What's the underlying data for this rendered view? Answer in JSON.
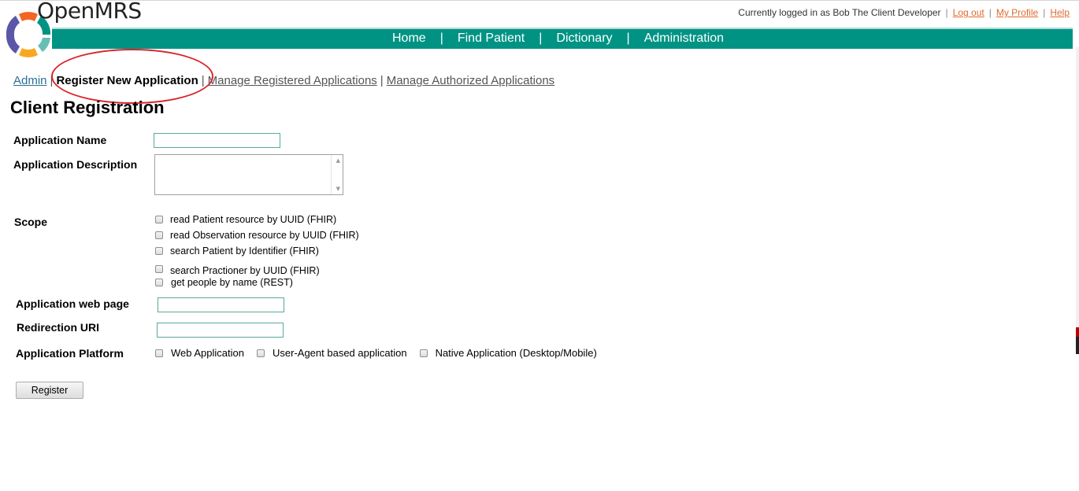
{
  "app": {
    "logo_text": "OpenMRS"
  },
  "userbar": {
    "logged_in_text": "Currently logged in as Bob The Client Developer",
    "logout": "Log out",
    "my_profile": "My Profile",
    "help": "Help"
  },
  "nav": [
    "Home",
    "Find Patient",
    "Dictionary",
    "Administration"
  ],
  "breadcrumbs": {
    "admin": "Admin",
    "register": "Register New Application",
    "manage_registered": "Manage Registered Applications",
    "manage_authorized": "Manage Authorized Applications"
  },
  "page_title": "Client Registration",
  "form": {
    "app_name_label": "Application Name",
    "app_desc_label": "Application Description",
    "scope_label": "Scope",
    "scopes": [
      "read Patient resource by UUID (FHIR)",
      "read Observation resource by UUID (FHIR)",
      "search Patient by Identifier (FHIR)",
      "search Practioner by UUID (FHIR)",
      "get  people by name (REST)"
    ],
    "web_page_label": "Application web page",
    "redirect_label": "Redirection URI",
    "platform_label": "Application Platform",
    "platforms": [
      "Web Application",
      "User-Agent based application",
      "Native Application (Desktop/Mobile)"
    ],
    "register_button": "Register"
  },
  "colors": {
    "nav_bg": "#009384",
    "link_orange": "#e06a2e",
    "annotation_circle": "#d9252b"
  }
}
